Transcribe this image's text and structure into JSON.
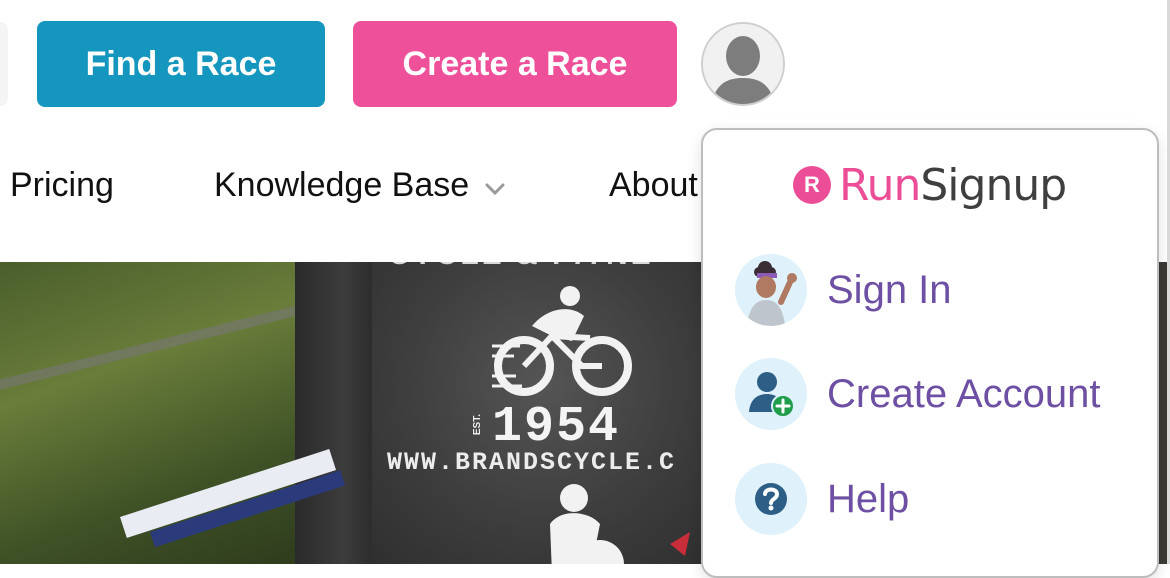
{
  "header": {
    "find_race_label": "Find a Race",
    "create_race_label": "Create a Race",
    "profile_icon": "user-avatar-icon"
  },
  "nav": {
    "items": [
      {
        "label": "Pricing"
      },
      {
        "label": "Knowledge Base"
      },
      {
        "label": "About"
      }
    ],
    "dropdown_icon": "chevron-down-icon"
  },
  "hero": {
    "year_text": "1954",
    "est_text": "EST.",
    "url_text": "WWW.BRANDSCYCLE.C",
    "top_text": "CYCLE & FITNE"
  },
  "account_menu": {
    "brand_run": "Run",
    "brand_signup": "Signup",
    "brand_mark": "R",
    "items": [
      {
        "label": "Sign In",
        "icon": "waving-person-icon"
      },
      {
        "label": "Create Account",
        "icon": "add-user-icon"
      },
      {
        "label": "Help",
        "icon": "question-icon"
      }
    ]
  },
  "colors": {
    "find_race_bg": "#1596be",
    "create_race_bg": "#ef509a",
    "brand_pink": "#ec4d97",
    "menu_text": "#6d4fa3",
    "icon_circle_bg": "#dff1fb"
  }
}
